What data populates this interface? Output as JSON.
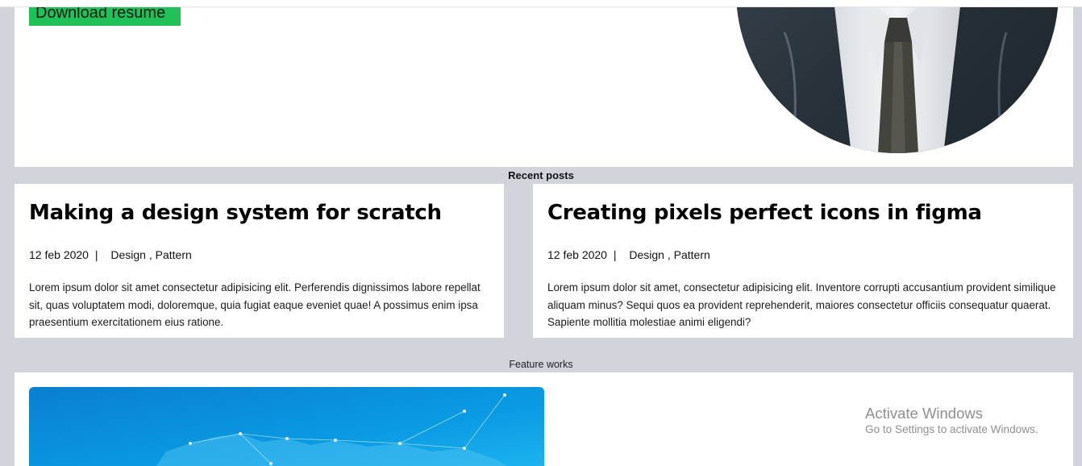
{
  "hero": {
    "download_label": "Download resume"
  },
  "recent_posts": {
    "heading": "Recent posts",
    "posts": [
      {
        "title": "Making a design system for scratch",
        "date": "12 feb 2020",
        "separator": "|",
        "tags": "Design , Pattern",
        "body": "Lorem ipsum dolor sit amet consectetur adipisicing elit. Perferendis dignissimos labore repellat sit, quas voluptatem modi, doloremque, quia fugiat eaque eveniet quae! A possimus enim ipsa praesentium exercitationem eius ratione."
      },
      {
        "title": "Creating pixels perfect icons in figma",
        "date": "12 feb 2020",
        "separator": "|",
        "tags": "Design , Pattern",
        "body": "Lorem ipsum dolor sit amet, consectetur adipisicing elit. Inventore corrupti accusantium provident similique aliquam minus? Sequi quos ea provident reprehenderit, maiores consectetur officiis consequatur quaerat. Sapiente mollitia molestiae animi eligendi?"
      }
    ]
  },
  "feature_works": {
    "heading": "Feature works"
  },
  "windows_watermark": {
    "title": "Activate Windows",
    "subtitle": "Go to Settings to activate Windows."
  },
  "colors": {
    "page_background": "#d1d4db",
    "card_background": "#ffffff",
    "button_green": "#21c15a",
    "image_blue": "#0a9be3"
  }
}
